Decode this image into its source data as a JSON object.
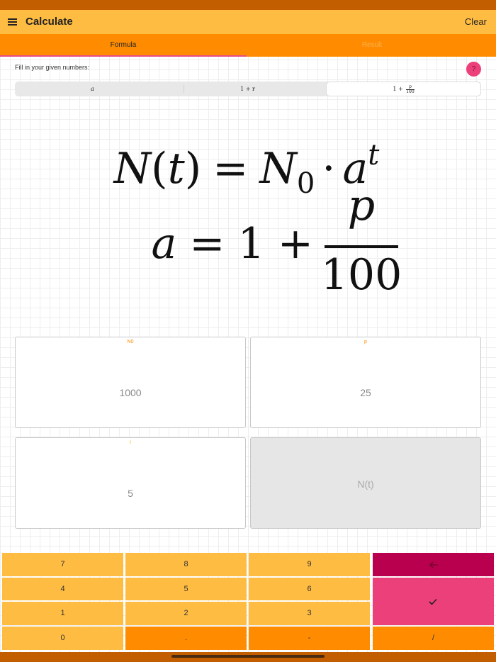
{
  "app_bar": {
    "title": "Calculate",
    "clear_label": "Clear"
  },
  "tabs": [
    {
      "label": "Formula"
    },
    {
      "label": "Result"
    }
  ],
  "instruction": "Fill in your given numbers:",
  "help": {
    "label": "?"
  },
  "segments": [
    {
      "text": "a"
    },
    {
      "text": "1 + r"
    },
    {
      "prefix": "1 + ",
      "numerator": "p",
      "denominator": "100"
    }
  ],
  "formula": {
    "line1": {
      "lhs_var": "N",
      "lhs_arg": "t",
      "eq": "=",
      "rhs_var": "N",
      "rhs_sub": "0",
      "op": "·",
      "base": "a",
      "exp": "t"
    },
    "line2": {
      "lhs": "a",
      "eq": "=",
      "one": "1",
      "op": "+",
      "numerator": "p",
      "denominator": "100"
    }
  },
  "inputs": [
    {
      "label": "N0",
      "value": "1000"
    },
    {
      "label": "p",
      "value": "25"
    },
    {
      "label": "t",
      "value": "5"
    },
    {
      "label": "",
      "value": "N(t)"
    }
  ],
  "keypad": {
    "keys": [
      "7",
      "8",
      "9",
      "4",
      "5",
      "6",
      "1",
      "2",
      "3",
      "0",
      ".",
      "-",
      "/"
    ],
    "backspace_icon": "backspace-arrow-icon",
    "confirm_icon": "checkmark-icon"
  },
  "colors": {
    "app_bar": "#ffbc42",
    "status_strip": "#c25d00",
    "tab_bar": "#ff8c00",
    "tab_indicator": "#e84a8a",
    "help_button": "#ec407a",
    "backspace_key": "#b8004e",
    "confirm_key": "#ec407a",
    "input_label": "#ff8c00",
    "input_label_t": "#f2c400"
  }
}
